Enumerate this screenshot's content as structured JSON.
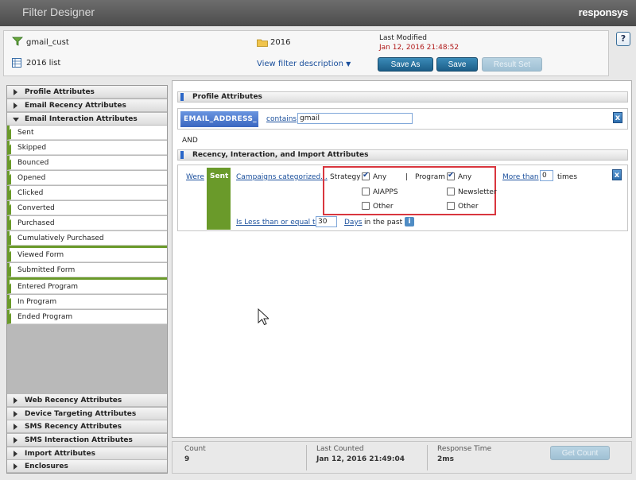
{
  "titlebar": {
    "title": "Filter Designer",
    "brand": "responsys"
  },
  "header": {
    "filter_name": "gmail_cust",
    "folder": "2016",
    "list": "2016 list",
    "view_description": "View filter description",
    "last_modified_label": "Last Modified",
    "last_modified_value": "Jan 12, 2016 21:48:52",
    "save_as": "Save As",
    "save": "Save",
    "result_set": "Result Set",
    "help": "?"
  },
  "sidebar": {
    "top_sections": [
      "Profile Attributes",
      "Email Recency Attributes",
      "Email Interaction Attributes"
    ],
    "items_group1": [
      "Sent",
      "Skipped",
      "Bounced",
      "Opened",
      "Clicked",
      "Converted",
      "Purchased",
      "Cumulatively Purchased"
    ],
    "items_group2": [
      "Viewed Form",
      "Submitted Form"
    ],
    "items_group3": [
      "Entered Program",
      "In Program",
      "Ended Program"
    ],
    "bottom_sections": [
      "Web Recency Attributes",
      "Device Targeting Attributes",
      "SMS Recency Attributes",
      "SMS Interaction Attributes",
      "Import Attributes",
      "Enclosures"
    ]
  },
  "main": {
    "profile_header": "Profile Attributes",
    "field_tag": "EMAIL_ADDRESS_",
    "operator": "contains",
    "value": "gmail",
    "and_label": "AND",
    "recency_header": "Recency, Interaction, and Import Attributes",
    "were": "Were",
    "sent_tag": "Sent",
    "campaigns_link": "Campaigns categorized...",
    "strategy_label": "Strategy",
    "program_label": "Program",
    "pipe": "|",
    "strategy_options": [
      {
        "label": "Any",
        "checked": true
      },
      {
        "label": "AIAPPS",
        "checked": false
      },
      {
        "label": "Other",
        "checked": false
      }
    ],
    "program_options": [
      {
        "label": "Any",
        "checked": true
      },
      {
        "label": "Newsletter",
        "checked": false
      },
      {
        "label": "Other",
        "checked": false
      }
    ],
    "more_than": "More than",
    "times_value": "0",
    "times": "times",
    "less_than": "Is Less than or equal to",
    "days_value": "30",
    "days": "Days",
    "in_the_past": "in the past",
    "close_symbol": "x",
    "info_symbol": "i"
  },
  "footer": {
    "count_label": "Count",
    "count_value": "9",
    "last_counted_label": "Last Counted",
    "last_counted_value": "Jan 12, 2016 21:49:04",
    "response_time_label": "Response Time",
    "response_time_value": "2ms",
    "get_count": "Get Count"
  },
  "colors": {
    "accent": "#1c5e88",
    "highlight_box": "#d9363e",
    "green": "#6a9a2a",
    "field_tag": "#4a7ad4"
  }
}
